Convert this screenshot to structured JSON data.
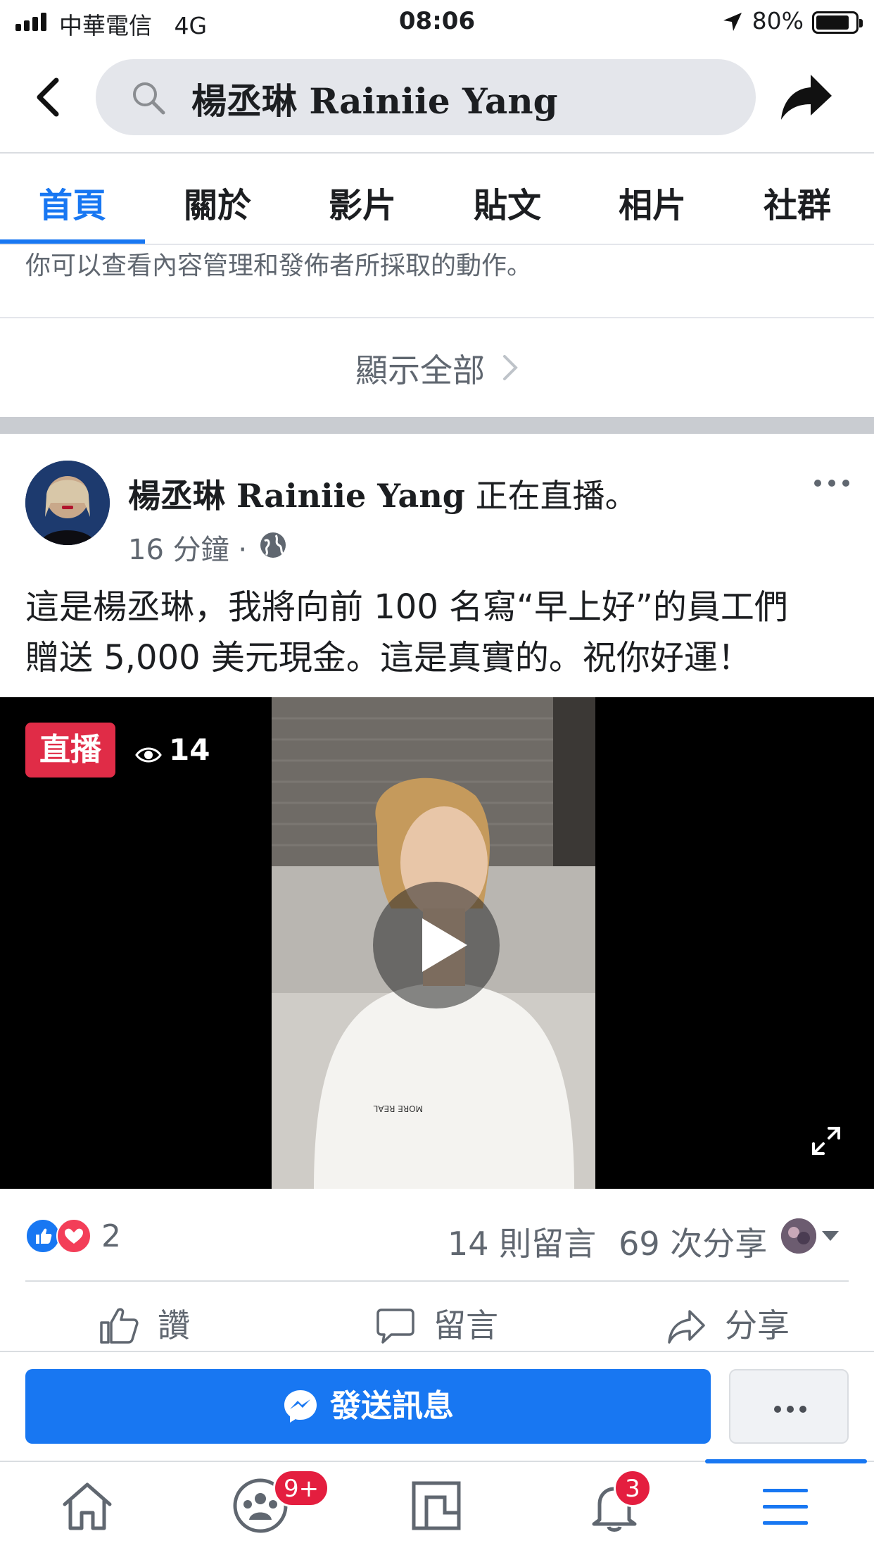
{
  "status_bar": {
    "carrier": "中華電信",
    "network": "4G",
    "time": "08:06",
    "battery": "80%"
  },
  "header": {
    "search_value": "楊丞琳 Rainiie Yang",
    "back_icon": "chevron-left-icon",
    "share_icon": "share-arrow-icon"
  },
  "tabs": [
    {
      "label": "首頁",
      "active": true
    },
    {
      "label": "關於",
      "active": false
    },
    {
      "label": "影片",
      "active": false
    },
    {
      "label": "貼文",
      "active": false
    },
    {
      "label": "相片",
      "active": false
    },
    {
      "label": "社群",
      "active": false
    }
  ],
  "notice": "你可以查看內容管理和發佈者所採取的動作。",
  "show_all": "顯示全部",
  "post": {
    "author": "楊丞琳 Rainiie Yang",
    "action": "正在直播。",
    "time": "16 分鐘",
    "separator": "·",
    "text_line1": "這是楊丞琳，我將向前 100 名寫“早上好”的員工們",
    "text_line2": "贈送 5,000 美元現金。這是真實的。祝你好運！",
    "video": {
      "live_label": "直播",
      "viewer_count": "14"
    },
    "reaction_count": "2",
    "comments": "14 則留言",
    "shares": "69 次分享",
    "actions": {
      "like": "讚",
      "comment": "留言",
      "share": "分享"
    }
  },
  "message_bar": {
    "send_label": "發送訊息"
  },
  "bottom_nav": {
    "groups_badge": "9+",
    "notifications_badge": "3"
  },
  "colors": {
    "accent": "#1877f2",
    "live": "#e02c47",
    "badge": "#e41e3f"
  }
}
